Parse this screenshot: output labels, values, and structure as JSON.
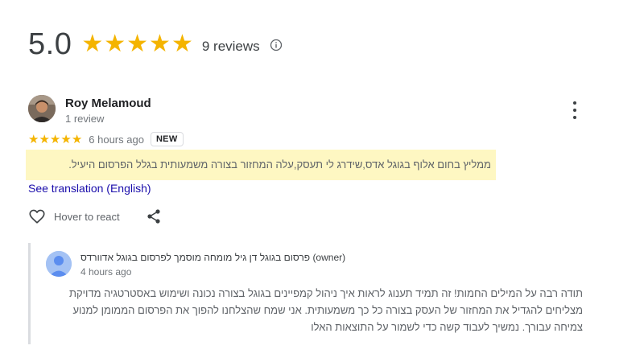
{
  "summary": {
    "rating": "5.0",
    "stars": "★★★★★",
    "review_count": "9 reviews",
    "star_color": "#f4b400"
  },
  "review": {
    "reviewer_name": "Roy Melamoud",
    "reviewer_meta": "1 review",
    "stars": "★★★★★",
    "time_ago": "6 hours ago",
    "badge": "NEW",
    "text": "ממליץ בחום אלוף בגוגל אדס,שידרג לי תעסק,עלה המחזור בצורה משמעותית בגלל הפרסום היעיל.",
    "highlight_color": "#fef7c2",
    "see_translation": "See translation (English)",
    "react_label": "Hover to react"
  },
  "owner_reply": {
    "name": "פרסום בגוגל דן גיל מומחה מוסמך לפרסום בגוגל אדוורדס",
    "owner_tag": "(owner)",
    "time_ago": "4 hours ago",
    "text": "תודה רבה על המילים החמות! זה תמיד תענוג לראות איך ניהול קמפיינים בגוגל בצורה נכונה ושימוש באסטרטגיה מדויקת מצליחים להגדיל את המחזור של העסק בצורה כל כך משמעותית. אני שמח שהצלחנו להפוך את הפרסום הממומן למנוע צמיחה עבורך. נמשיך לעבוד קשה כדי לשמור על התוצאות האלו"
  },
  "icons": {
    "info": "info-icon",
    "more": "more-vert-icon",
    "heart": "heart-outline-icon",
    "share": "share-icon"
  }
}
